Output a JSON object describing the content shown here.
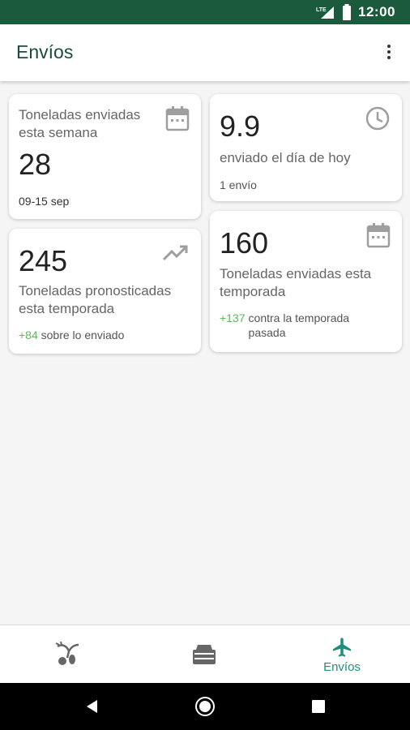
{
  "status_bar": {
    "network": "LTE",
    "time": "12:00"
  },
  "app_bar": {
    "title": "Envíos"
  },
  "cards": {
    "week": {
      "label": "Toneladas enviadas esta semana",
      "value": "28",
      "date_range": "09-15 sep",
      "icon": "calendar-icon"
    },
    "today": {
      "value": "9.9",
      "label": "enviado el día de hoy",
      "count": "1 envío",
      "icon": "clock-icon"
    },
    "forecast": {
      "value": "245",
      "label": "Toneladas pronosticadas esta temporada",
      "delta": "+84",
      "delta_text": "sobre lo enviado",
      "icon": "trending-up-icon"
    },
    "season": {
      "value": "160",
      "label": "Toneladas enviadas esta temporada",
      "delta": "+137",
      "delta_text": "contra la temporada pasada",
      "icon": "calendar-icon"
    }
  },
  "bottom_nav": {
    "items": [
      {
        "name": "crop",
        "label": "",
        "icon": "plant-sprout-icon"
      },
      {
        "name": "storage",
        "label": "",
        "icon": "warehouse-icon"
      },
      {
        "name": "shipments",
        "label": "Envíos",
        "icon": "airplane-icon",
        "active": true
      }
    ]
  },
  "colors": {
    "brand": "#1c5a3d",
    "accent": "#1f8f7a",
    "positive": "#5cb85c"
  }
}
